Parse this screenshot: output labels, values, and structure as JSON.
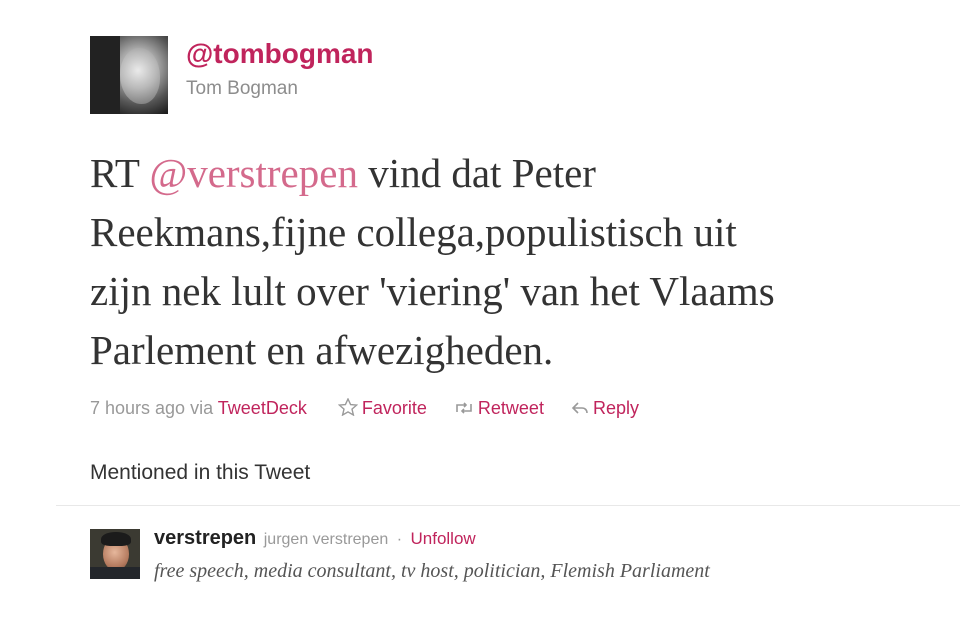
{
  "author": {
    "screen_name": "@tombogman",
    "full_name": "Tom Bogman"
  },
  "tweet": {
    "prefix": "RT ",
    "mention": "@verstrepen",
    "line1_rest": " vind dat Peter",
    "line2": "Reekmans,fijne collega,populistisch uit",
    "line3": "zijn nek lult over 'viering' van het Vlaams",
    "line4": "Parlement en afwezigheden."
  },
  "meta": {
    "time": "7 hours ago",
    "via_label": "via",
    "source": "TweetDeck",
    "favorite_label": "Favorite",
    "retweet_label": "Retweet",
    "reply_label": "Reply"
  },
  "mentioned": {
    "title": "Mentioned in this Tweet",
    "user": {
      "screen_name": "verstrepen",
      "full_name": "jurgen verstrepen",
      "separator": "·",
      "action_label": "Unfollow",
      "bio": "free speech, media consultant, tv host, politician, Flemish Parliament"
    }
  },
  "colors": {
    "link": "#c0245c",
    "mention": "#d46a8c",
    "text": "#333333",
    "muted": "#999999"
  },
  "icons": {
    "favorite": "star-icon",
    "retweet": "retweet-icon",
    "reply": "reply-icon"
  }
}
